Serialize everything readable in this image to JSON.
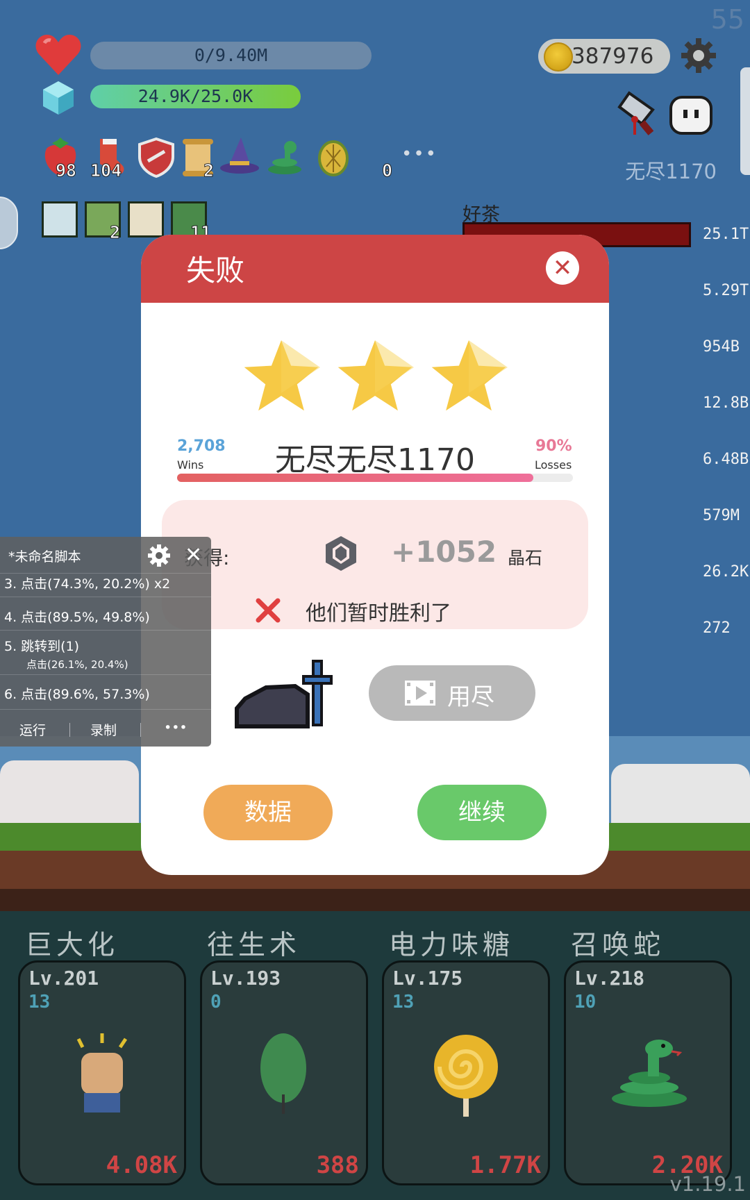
{
  "hud": {
    "fps": "55",
    "hp": "0/9.40M",
    "mana": "24.9K/25.0K",
    "coins": "387976",
    "endless_label": "无尽1170",
    "item_counts": [
      "98",
      "104",
      "2",
      "0"
    ],
    "skill_counts": [
      "2",
      "11"
    ]
  },
  "boss": {
    "name": "好茶",
    "damage_list": [
      "25.1T",
      "5.29T",
      "954B",
      "12.8B",
      "6.48B",
      "579M",
      "26.2K",
      "272"
    ]
  },
  "dialog": {
    "title": "失败",
    "close_icon": "close-icon",
    "stars": 3,
    "wins": "2,708",
    "wins_label": "Wins",
    "losses": "90%",
    "losses_label": "Losses",
    "win_fraction": 0.9,
    "stage": "无尽无尽1170",
    "reward_label": "获得:",
    "reward_amount": "+1052",
    "reward_unit": "晶石",
    "lose_message": "他们暂时胜利了",
    "video_button": "用尽",
    "data_button": "数据",
    "continue_button": "继续"
  },
  "script_panel": {
    "title": "*未命名脚本",
    "steps": [
      "3. 点击(74.3%, 20.2%) x2",
      "4. 点击(89.5%, 49.8%)",
      "5. 跳转到(1)",
      "点击(26.1%, 20.4%)",
      "6. 点击(89.6%, 57.3%)"
    ],
    "run": "运行",
    "record": "录制",
    "more": "•••"
  },
  "skills": [
    {
      "name": "巨大化",
      "level": "Lv.201",
      "sub": "13",
      "cost": "4.08K",
      "icon": "fist-icon"
    },
    {
      "name": "往生术",
      "level": "Lv.193",
      "sub": "0",
      "cost": "388",
      "icon": "leaf-icon"
    },
    {
      "name": "电力味糖",
      "level": "Lv.175",
      "sub": "13",
      "cost": "1.77K",
      "icon": "lollipop-icon"
    },
    {
      "name": "召唤蛇",
      "level": "Lv.218",
      "sub": "10",
      "cost": "2.20K",
      "icon": "snake-icon"
    }
  ],
  "version": "v1.19.1",
  "colors": {
    "sky": "#3a6b9e",
    "dialog_header": "#cd4545",
    "data_button": "#f0aa58",
    "continue_button": "#69c96a",
    "cost_red": "#d04545"
  }
}
